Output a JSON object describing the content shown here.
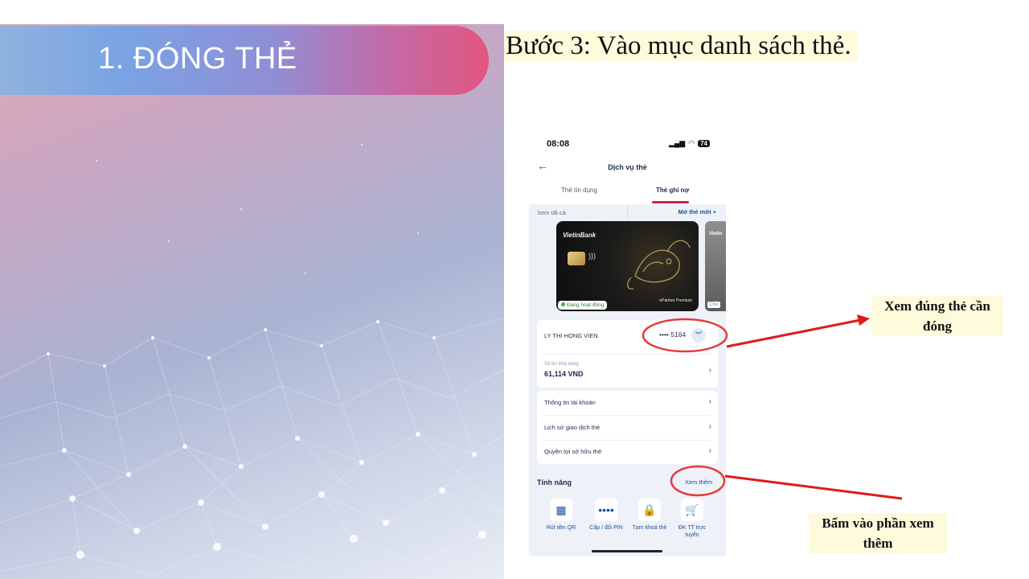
{
  "slide": {
    "section_title": "1. ĐÓNG THẺ",
    "step_title": "Bước 3: Vào mục danh sách thẻ."
  },
  "phone": {
    "status_time": "08:08",
    "status_battery": "74",
    "screen_title": "Dịch vụ thẻ",
    "tabs": [
      {
        "label": "Thẻ tín dụng",
        "active": false
      },
      {
        "label": "Thẻ ghi nợ",
        "active": true
      }
    ],
    "see_all": "Xem tất cả",
    "open_new_card": "Mở thẻ mới +",
    "card": {
      "brand": "VietinBank",
      "partner": "ePartner",
      "partner_sub": "Premium",
      "status": "Đang hoạt động",
      "next_card_brand": "Vietin",
      "next_card_status": "Chư"
    },
    "holder": {
      "name": "LY THI HONG VIEN",
      "card_mask": "•••• 5164",
      "balance_label": "Số dư khả dụng",
      "balance_value": "61,114 VND"
    },
    "menu_items": [
      "Thông tin tài khoản",
      "Lịch sử giao dịch thẻ",
      "Quyền lợi sở hữu thẻ"
    ],
    "features_title": "Tính năng",
    "see_more": "Xem thêm",
    "features": [
      {
        "icon": "qr-icon",
        "label": "Rút tiền QR"
      },
      {
        "icon": "pin-icon",
        "label": "Cấp / đổi PIN"
      },
      {
        "icon": "lock-card-icon",
        "label": "Tạm khoá thẻ"
      },
      {
        "icon": "cart-icon",
        "label": "ĐK TT trực tuyến"
      }
    ]
  },
  "annotations": {
    "card_note": "Xem đúng thẻ cần đóng",
    "more_note": "Bấm vào phần xem thêm"
  },
  "colors": {
    "accent_red": "#e01a1a",
    "brand_blue": "#1b4f9b",
    "tab_underline": "#d12148"
  }
}
